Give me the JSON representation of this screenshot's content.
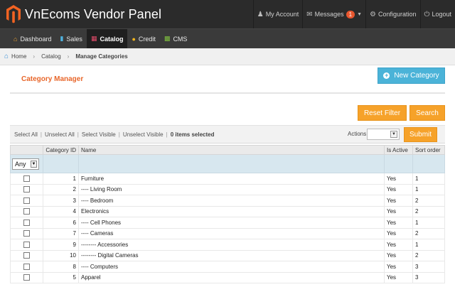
{
  "header": {
    "title": "VnEcoms Vendor Panel",
    "links": {
      "account": "My Account",
      "messages": "Messages",
      "messages_count": "1",
      "configuration": "Configuration",
      "logout": "Logout"
    }
  },
  "nav": {
    "dashboard": "Dashboard",
    "sales": "Sales",
    "catalog": "Catalog",
    "credit": "Credit",
    "cms": "CMS"
  },
  "breadcrumb": {
    "home": "Home",
    "catalog": "Catalog",
    "current": "Manage Categories"
  },
  "page": {
    "title": "Category Manager",
    "new_button": "New Category",
    "reset_filter": "Reset Filter",
    "search": "Search"
  },
  "massaction": {
    "select_all": "Select All",
    "unselect_all": "Unselect All",
    "select_visible": "Select Visible",
    "unselect_visible": "Unselect Visible",
    "items_selected": "0 items selected",
    "actions_label": "Actions",
    "submit": "Submit"
  },
  "grid": {
    "columns": {
      "category_id": "Category ID",
      "name": "Name",
      "is_active": "Is Active",
      "sort_order": "Sort order"
    },
    "filter_any": "Any",
    "rows": [
      {
        "id": "1",
        "name": "Furniture",
        "active": "Yes",
        "sort": "1"
      },
      {
        "id": "2",
        "name": "---- Living Room",
        "active": "Yes",
        "sort": "1"
      },
      {
        "id": "3",
        "name": "---- Bedroom",
        "active": "Yes",
        "sort": "2"
      },
      {
        "id": "4",
        "name": "Electronics",
        "active": "Yes",
        "sort": "2"
      },
      {
        "id": "6",
        "name": "---- Cell Phones",
        "active": "Yes",
        "sort": "1"
      },
      {
        "id": "7",
        "name": "---- Cameras",
        "active": "Yes",
        "sort": "2"
      },
      {
        "id": "9",
        "name": "-------- Accessories",
        "active": "Yes",
        "sort": "1"
      },
      {
        "id": "10",
        "name": "-------- Digital Cameras",
        "active": "Yes",
        "sort": "2"
      },
      {
        "id": "8",
        "name": "---- Computers",
        "active": "Yes",
        "sort": "3"
      },
      {
        "id": "5",
        "name": "Apparel",
        "active": "Yes",
        "sort": "3"
      }
    ]
  }
}
